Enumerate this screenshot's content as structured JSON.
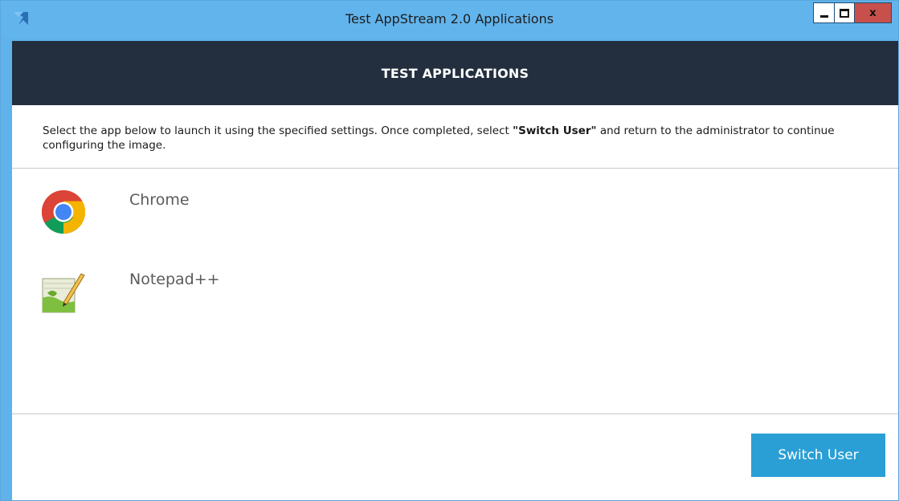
{
  "window": {
    "title": "Test AppStream 2.0 Applications",
    "controls": {
      "minimize": "minimize",
      "maximize": "maximize",
      "close_label": "x"
    },
    "colors": {
      "titlebar": "#62b4ec",
      "close": "#c7504c"
    }
  },
  "header": {
    "title": "TEST APPLICATIONS",
    "background": "#232f3e"
  },
  "instructions": {
    "before": "Select the app below to launch it using the specified settings. Once completed, select ",
    "bold": "\"Switch User\"",
    "after": " and return to the administrator to continue configuring the image."
  },
  "apps": [
    {
      "name": "Chrome",
      "icon": "chrome-icon"
    },
    {
      "name": "Notepad++",
      "icon": "notepad-plus-plus-icon"
    }
  ],
  "footer": {
    "switch_user_label": "Switch User",
    "button_color": "#2a9fd6"
  }
}
